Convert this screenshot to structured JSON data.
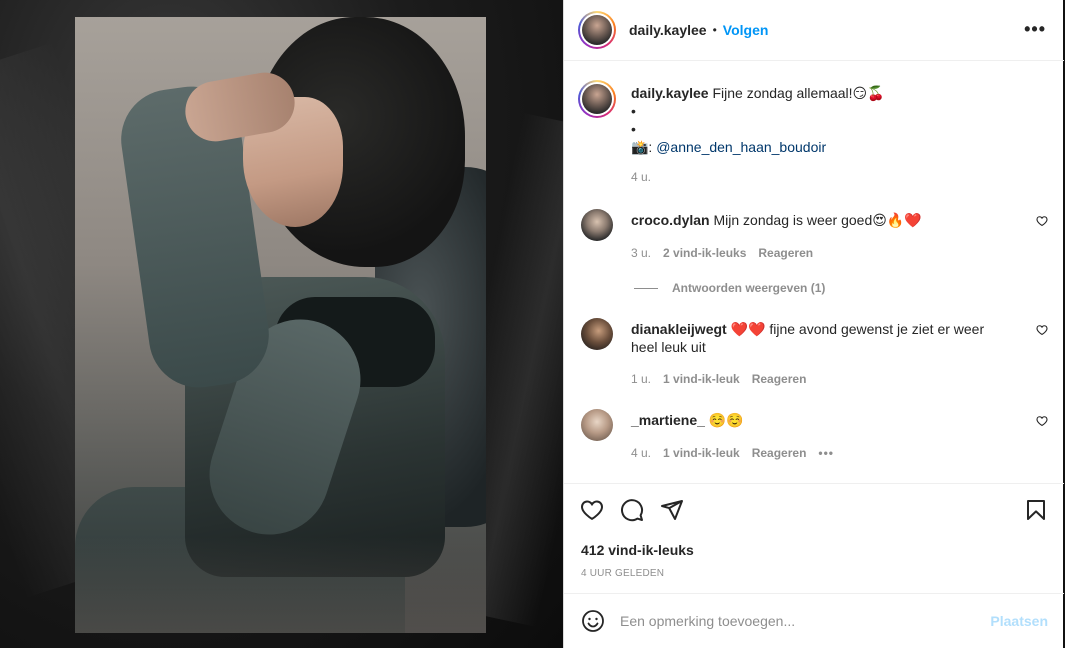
{
  "post": {
    "author": "daily.kaylee",
    "follow_label": "Volgen",
    "more_icon": "more-options-icon",
    "caption": {
      "username": "daily.kaylee",
      "text": "Fijne zondag allemaal!😏🍒",
      "line2": "•",
      "line3": "•",
      "camera": "📸:",
      "mention": "@anne_den_haan_boudoir",
      "time": "4 u."
    },
    "likes": "412 vind-ik-leuks",
    "posted": "4 UUR GELEDEN"
  },
  "comments": [
    {
      "username": "croco.dylan",
      "text": "Mijn zondag is weer goed😍🔥❤️",
      "time": "3 u.",
      "likes": "2 vind-ik-leuks",
      "reply": "Reageren"
    },
    {
      "username": "dianakleijwegt",
      "text": "❤️❤️ fijne avond gewenst je ziet er weer heel leuk uit",
      "time": "1 u.",
      "likes": "1 vind-ik-leuk",
      "reply": "Reageren"
    },
    {
      "username": "_martiene_",
      "text": "☺️☺️",
      "time": "4 u.",
      "likes": "1 vind-ik-leuk",
      "reply": "Reageren",
      "more": "•••"
    }
  ],
  "view_replies": "Antwoorden weergeven (1)",
  "add_comment": {
    "placeholder": "Een opmerking toevoegen...",
    "post_label": "Plaatsen"
  },
  "colors": {
    "accent": "#0095f6",
    "muted": "#8e8e8e",
    "post_disabled": "#b2dffc"
  }
}
